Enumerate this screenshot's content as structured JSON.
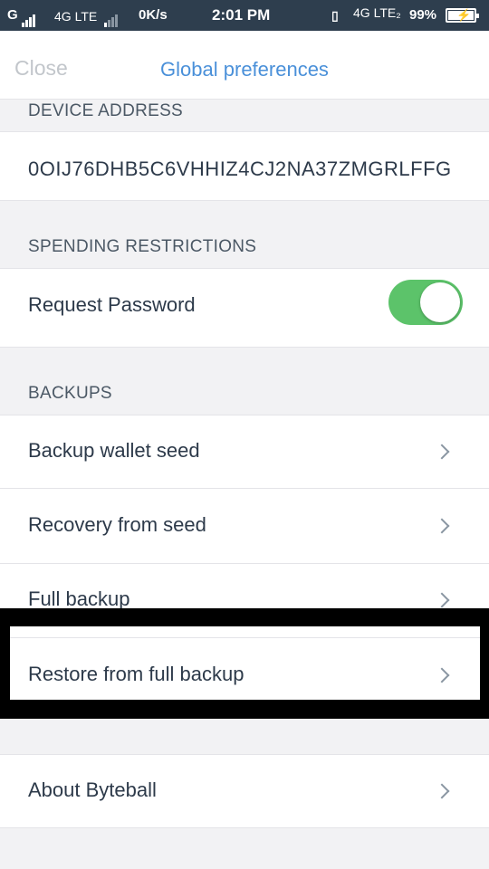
{
  "status_bar": {
    "carrier1": "G",
    "network1": "4G LTE",
    "speed": "0K/s",
    "time": "2:01 PM",
    "network2": "4G LTE₂",
    "battery_percent": "99%"
  },
  "header": {
    "close_label": "Close",
    "title": "Global preferences"
  },
  "device_address": {
    "section_title": "DEVICE ADDRESS",
    "value": "0OIJ76DHB5C6VHHIZ4CJ2NA37ZMGRLFFG"
  },
  "spending_restrictions": {
    "section_title": "SPENDING RESTRICTIONS",
    "request_password_label": "Request Password",
    "request_password_enabled": true
  },
  "backups": {
    "section_title": "BACKUPS",
    "items": [
      {
        "label": "Backup wallet seed"
      },
      {
        "label": "Recovery from seed"
      },
      {
        "label": "Full backup"
      },
      {
        "label": "Restore from full backup"
      }
    ]
  },
  "about": {
    "label": "About Byteball"
  },
  "colors": {
    "status_bar_bg": "#2e3e4e",
    "accent": "#4a90d9",
    "toggle_on": "#5cc36a",
    "page_bg": "#f2f2f4"
  }
}
